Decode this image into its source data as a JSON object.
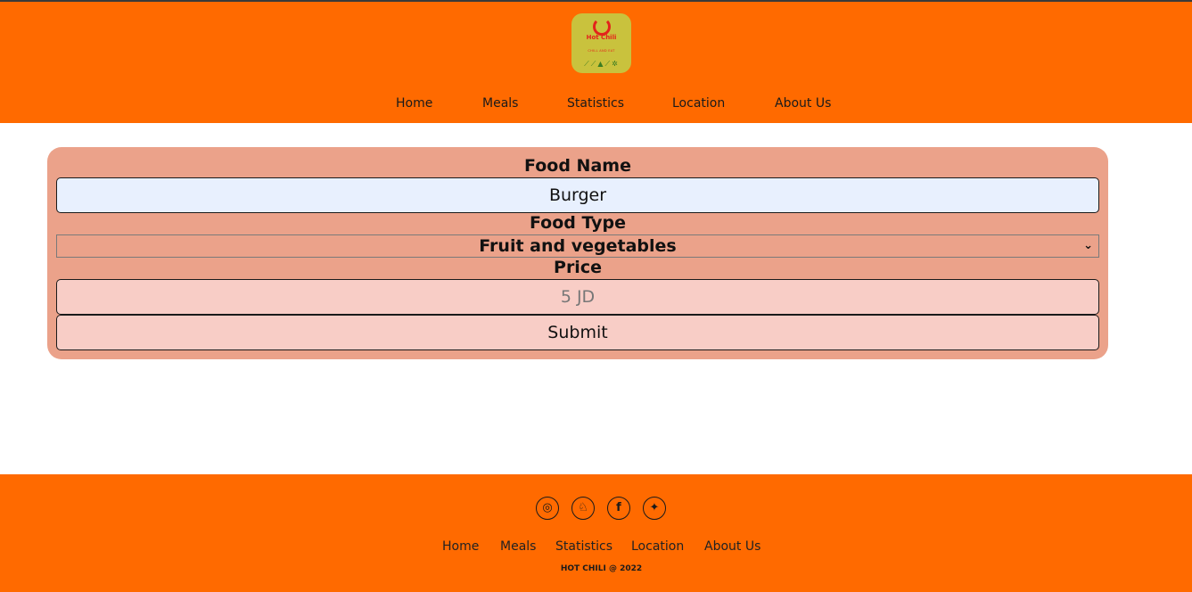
{
  "header": {
    "logo": {
      "brand": "Hot Chili",
      "tagline": "CHILL AND EAT"
    },
    "nav": [
      "Home",
      "Meals",
      "Statistics",
      "Location",
      "About Us"
    ]
  },
  "form": {
    "food_name_label": "Food Name",
    "food_name_value": "Burger",
    "food_type_label": "Food Type",
    "food_type_selected": "Fruit and vegetables",
    "price_label": "Price",
    "price_placeholder": "5 JD",
    "submit_label": "Submit"
  },
  "footer": {
    "social_icons": [
      "instagram-icon",
      "snapchat-icon",
      "facebook-icon",
      "twitter-icon"
    ],
    "nav": [
      "Home",
      "Meals",
      "Statistics",
      "Location",
      "About Us"
    ],
    "copyright": "HOT CHILI @ 2022"
  },
  "colors": {
    "header_bg": "#ff6a00",
    "card_bg": "#eba28a",
    "input_bg": "#f8cdc6",
    "autofill_bg": "#e8f0fe"
  }
}
